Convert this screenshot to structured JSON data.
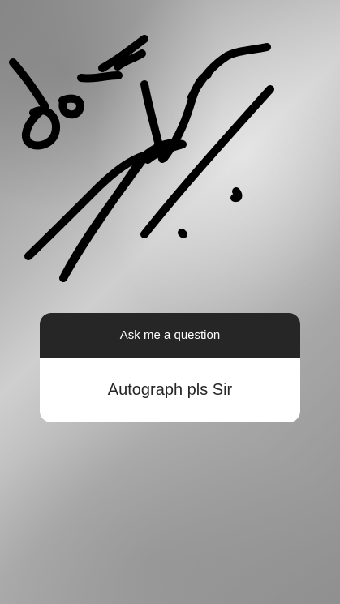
{
  "question_sticker": {
    "prompt": "Ask me a question",
    "answer": "Autograph pls Sir"
  },
  "colors": {
    "ink": "#000000",
    "sticker_header": "#262626",
    "sticker_body": "#ffffff"
  }
}
